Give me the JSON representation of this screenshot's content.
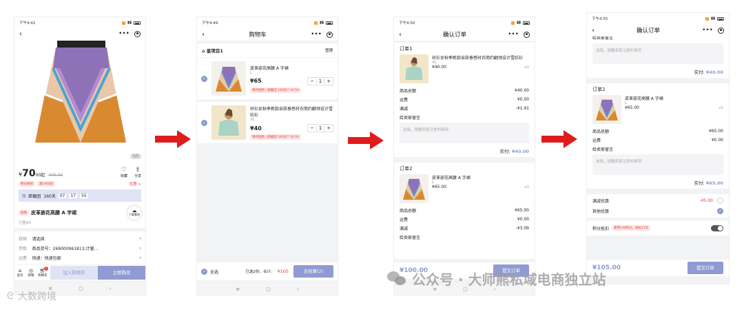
{
  "arrows_color": "#e01b1b",
  "accent": "#8f9bd2",
  "screen1": {
    "time": "下午4:42",
    "image_counter": "1/2",
    "price": "70",
    "price_unit": "00起",
    "orig_price": "¥95.00",
    "currency": "¥",
    "fav_label": "收藏",
    "share_label": "分享",
    "tags": [
      "积分抵扣",
      "满100减5"
    ],
    "promo_link": "优惠 >",
    "countdown_label": "距截团",
    "countdown_days": "160天",
    "countdown_h": "07",
    "countdown_m": "17",
    "countdown_s": "55",
    "badge": "团购",
    "title": "皮革嵌花高腰 A 字裙",
    "sold": "已售80",
    "download_label": "下载素材",
    "spec_key": "规格",
    "spec_val": "请选择",
    "param_key": "参数",
    "param_val": "商品货号：269000961813;计量...",
    "ship_key": "运费",
    "ship_val": "快递：快递包邮",
    "tab_home": "首页",
    "tab_shop": "购物",
    "tab_cart": "购物车",
    "cart_badge": "1",
    "add_cart": "加入购物车",
    "buy_now": "立即购买"
  },
  "screen2": {
    "time": "下午4:49",
    "title": "购物车",
    "store": "星项目1",
    "manage": "管理",
    "items": [
      {
        "name": "皮革嵌花高腰 A 字裙",
        "spec": "L",
        "price": "¥65",
        "qty": "1",
        "promo": "限时团购 | 距截团 160天7:10:50"
      },
      {
        "name": "衬衫女秋季新款亲肤垂感衬衣简约翻领设计雪纺衫",
        "spec": "XL",
        "price": "¥40",
        "qty": "1",
        "promo": "限时团购 | 距截团 160天7:10:50"
      }
    ],
    "select_all": "全选",
    "summary": "已选2份，合计：",
    "total": "¥105",
    "checkout": "去结算(2)"
  },
  "screen3": {
    "time": "下午4:50",
    "title": "确认订单",
    "order1_label": "订单1",
    "order1_item": {
      "name": "衬衫女秋季新款亲肤垂感衬衣简约翻领设计雪纺衫",
      "spec": "XL",
      "price": "¥40.00",
      "qty": "x1"
    },
    "order1_rows": [
      {
        "k": "商品总额",
        "v": "¥40.00"
      },
      {
        "k": "运费",
        "v": "¥0.00"
      },
      {
        "k": "满减",
        "v": "-¥1.91"
      }
    ],
    "note_label": "给卖家留言",
    "note_placeholder": "选填，提醒卖家注意的事项",
    "paid_label": "实付:",
    "paid1": "¥40.00",
    "order2_label": "订单2",
    "order2_item": {
      "name": "皮革嵌花高腰 A 字裙",
      "spec": "L",
      "price": "¥65.00",
      "qty": "x1"
    },
    "order2_rows": [
      {
        "k": "商品总额",
        "v": "¥65.00"
      },
      {
        "k": "运费",
        "v": "¥0.00"
      },
      {
        "k": "满减",
        "v": "-¥3.09"
      }
    ],
    "note2_label": "给卖家留言",
    "bottom_total": "¥100.00",
    "submit": "提交订单"
  },
  "screen4": {
    "time": "下午4:55",
    "title": "确认订单",
    "note_label": "给卖家留言",
    "note_placeholder": "选填，提醒卖家注意的事项",
    "paid_label": "实付:",
    "paid1": "¥40.00",
    "order2_label": "订单2",
    "order2_item": {
      "name": "皮革嵌花高腰 A 字裙",
      "spec": "L",
      "price": "¥65.00",
      "qty": "x1"
    },
    "order2_rows": [
      {
        "k": "商品总额",
        "v": "¥65.00"
      },
      {
        "k": "运费",
        "v": "¥0.00"
      }
    ],
    "note2_label": "给卖家留言",
    "paid2": "¥65.00",
    "discount_label": "满减优惠",
    "discount_val": "-¥5.00",
    "other_label": "其他优惠",
    "points_label": "积分抵扣",
    "points_tag": "使用130积分，抵扣13元",
    "bottom_total": "¥105.00",
    "submit": "提交订单"
  },
  "watermark_left": "大数跨境",
  "watermark_right": "公众号 · 大师熊私域电商独立站"
}
